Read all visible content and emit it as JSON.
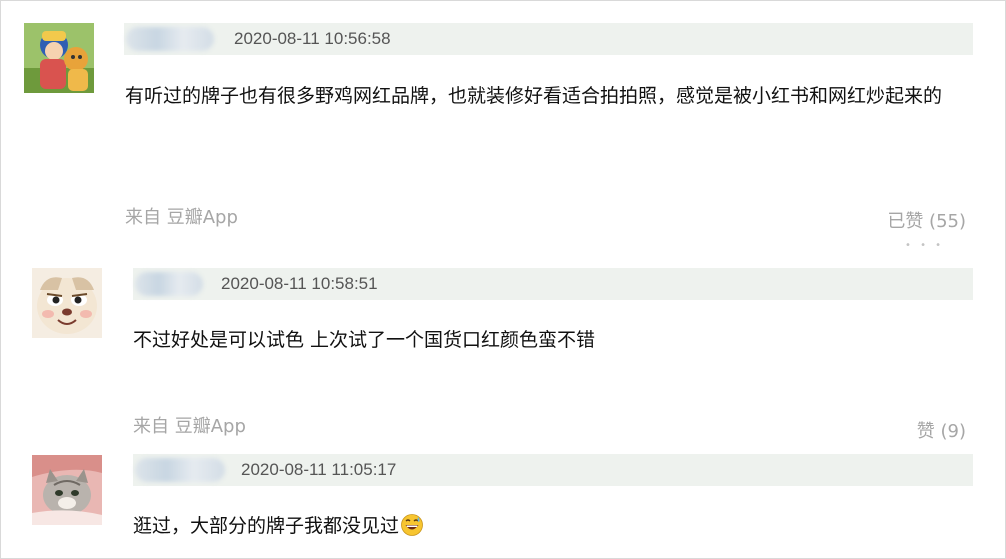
{
  "comments": [
    {
      "time": "2020-08-11 10:56:58",
      "content": "有听过的牌子也有很多野鸡网红品牌，也就装修好看适合拍拍照，感觉是被小红书和网红炒起来的",
      "source": "来自 豆瓣App",
      "likes": "已赞 (55)"
    },
    {
      "time": "2020-08-11 10:58:51",
      "content": "不过好处是可以试色 上次试了一个国货口红颜色蛮不错",
      "source": "来自 豆瓣App",
      "likes": "赞 (9)"
    },
    {
      "time": "2020-08-11 11:05:17",
      "content": "逛过，大部分的牌子我都没见过",
      "emoji": "grinning-sweat-emoji"
    }
  ],
  "colors": {
    "header_bg": "#eef2ee",
    "muted_text": "#a6a6a6",
    "time_text": "#555555"
  }
}
